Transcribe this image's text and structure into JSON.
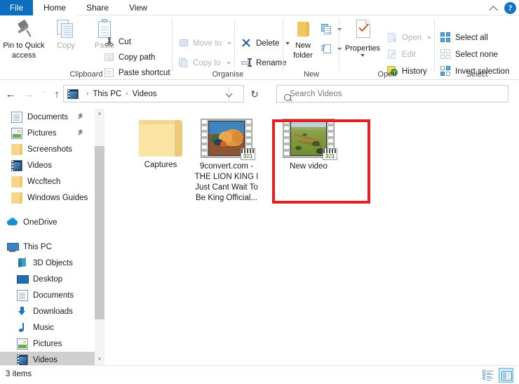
{
  "tabs": [
    {
      "label": "File",
      "id": "file"
    },
    {
      "label": "Home",
      "id": "home"
    },
    {
      "label": "Share",
      "id": "share"
    },
    {
      "label": "View",
      "id": "view"
    }
  ],
  "titlebar": {
    "collapse_icon": "chevron-up-icon",
    "help_icon": "help-icon",
    "help_glyph": "?"
  },
  "ribbon": {
    "groups": [
      {
        "label": "Clipboard",
        "big_buttons": [
          {
            "label_line1": "Pin to Quick",
            "label_line2": "access",
            "icon": "pin-icon",
            "disabled": false
          },
          {
            "label_line1": "Copy",
            "label_line2": "",
            "icon": "copy-icon",
            "disabled": true
          },
          {
            "label_line1": "Paste",
            "label_line2": "",
            "icon": "paste-icon",
            "disabled": true
          }
        ],
        "small_items": [
          {
            "label": "Cut",
            "icon": "scissors-icon",
            "disabled": false
          },
          {
            "label": "Copy path",
            "icon": "copy-path-icon",
            "disabled": false
          },
          {
            "label": "Paste shortcut",
            "icon": "paste-shortcut-icon",
            "disabled": false
          }
        ]
      },
      {
        "label": "Organise",
        "small_items": [
          {
            "label": "Move to",
            "icon": "move-to-icon",
            "disabled": true,
            "has_dropdown": true
          },
          {
            "label": "Copy to",
            "icon": "copy-to-icon",
            "disabled": true,
            "has_dropdown": true
          },
          {
            "label": "Delete",
            "icon": "delete-x-icon",
            "disabled": false,
            "has_dropdown": true
          },
          {
            "label": "Rename",
            "icon": "rename-icon",
            "disabled": false,
            "has_dropdown": false
          }
        ]
      },
      {
        "label": "New",
        "big_buttons": [
          {
            "label_line1": "New",
            "label_line2": "folder",
            "icon": "new-folder-icon",
            "disabled": false
          }
        ],
        "small_items": [
          {
            "label": "",
            "icon": "new-item-icon",
            "has_dropdown": true
          },
          {
            "label": "",
            "icon": "easy-access-icon",
            "has_dropdown": true
          }
        ]
      },
      {
        "label": "Open",
        "big_buttons": [
          {
            "label_line1": "Properties",
            "label_line2": "",
            "icon": "properties-icon",
            "disabled": false,
            "has_dropdown": true
          }
        ],
        "small_items": [
          {
            "label": "Open",
            "icon": "open-icon",
            "disabled": true,
            "has_dropdown": true
          },
          {
            "label": "Edit",
            "icon": "edit-icon",
            "disabled": true,
            "has_dropdown": false
          },
          {
            "label": "History",
            "icon": "history-icon",
            "disabled": false,
            "has_dropdown": false
          }
        ]
      },
      {
        "label": "Select",
        "small_items": [
          {
            "label": "Select all",
            "icon": "select-all-icon",
            "disabled": false
          },
          {
            "label": "Select none",
            "icon": "select-none-icon",
            "disabled": false
          },
          {
            "label": "Invert selection",
            "icon": "invert-selection-icon",
            "disabled": false
          }
        ]
      }
    ]
  },
  "address_bar": {
    "back_glyph": "←",
    "forward_glyph": "→",
    "recent_glyph": "ˇ",
    "up_glyph": "↑",
    "path_icon": "videos-folder-icon",
    "crumbs": [
      "This PC",
      "Videos"
    ],
    "separator": "›",
    "dropdown_icon": "chevron-down-icon",
    "refresh_glyph": "↻",
    "refresh_icon": "refresh-icon"
  },
  "search": {
    "icon": "search-icon",
    "placeholder": "Search Videos",
    "value": ""
  },
  "sidebar": {
    "quick_access_items": [
      {
        "label": "Documents",
        "icon": "documents-icon",
        "pinned": true,
        "selected": false
      },
      {
        "label": "Pictures",
        "icon": "pictures-icon",
        "pinned": true,
        "selected": false
      },
      {
        "label": "Screenshots",
        "icon": "folder-icon",
        "pinned": false,
        "selected": false
      },
      {
        "label": "Videos",
        "icon": "videos-icon",
        "pinned": false,
        "selected": false
      },
      {
        "label": "Wccftech",
        "icon": "folder-icon",
        "pinned": false,
        "selected": false
      },
      {
        "label": "Windows Guides",
        "icon": "folder-icon",
        "pinned": false,
        "selected": false
      }
    ],
    "onedrive": {
      "label": "OneDrive",
      "icon": "onedrive-icon"
    },
    "this_pc": {
      "label": "This PC",
      "icon": "this-pc-icon"
    },
    "this_pc_children": [
      {
        "label": "3D Objects",
        "icon": "3d-objects-icon",
        "selected": false
      },
      {
        "label": "Desktop",
        "icon": "desktop-icon",
        "selected": false
      },
      {
        "label": "Documents",
        "icon": "documents-icon",
        "selected": false
      },
      {
        "label": "Downloads",
        "icon": "downloads-icon",
        "selected": false
      },
      {
        "label": "Music",
        "icon": "music-icon",
        "selected": false
      },
      {
        "label": "Pictures",
        "icon": "pictures-icon",
        "selected": false
      },
      {
        "label": "Videos",
        "icon": "videos-icon",
        "selected": true
      }
    ],
    "scroll": {
      "up_glyph": "˄",
      "down_glyph": "˅"
    }
  },
  "content": {
    "items": [
      {
        "name": "Captures",
        "type": "folder",
        "caption_lines": [
          "Captures"
        ],
        "selected": false
      },
      {
        "name": "9convert.com - THE LION KING I Just Cant Wait To Be King Official...",
        "type": "video",
        "caption_lines": [
          "9convert.com -",
          "THE LION KING I",
          "Just Cant Wait To",
          "Be King Official..."
        ],
        "badge_digits": [
          "3",
          "2",
          "1"
        ],
        "selected": false
      },
      {
        "name": "New video",
        "type": "video",
        "caption_lines": [
          "New video"
        ],
        "badge_digits": [
          "3",
          "2",
          "1"
        ],
        "selected": false,
        "highlighted": true
      }
    ],
    "highlight_color": "#e52020"
  },
  "status_bar": {
    "item_count_label": "3 items",
    "view_buttons": [
      {
        "name": "details-view-button",
        "icon": "details-view-icon",
        "active": false
      },
      {
        "name": "large-icons-view-button",
        "icon": "large-icons-view-icon",
        "active": true
      }
    ]
  }
}
